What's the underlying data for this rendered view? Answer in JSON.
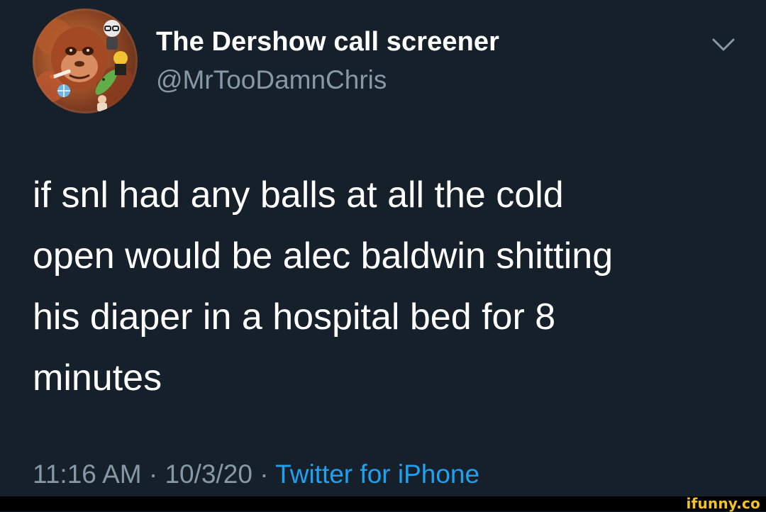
{
  "tweet": {
    "display_name": "The Dershow call screener",
    "handle": "@MrTooDamnChris",
    "text_lines": [
      "if snl had any balls at all the cold",
      "open would be alec baldwin shitting",
      "his diaper in a hospital bed for 8",
      "minutes"
    ],
    "time": "11:16 AM",
    "separator": "·",
    "date": "10/3/20",
    "source": "Twitter for iPhone"
  },
  "watermark": "ifunny.co",
  "colors": {
    "background": "#15202b",
    "text_primary": "#ffffff",
    "text_secondary": "#8899a6",
    "link": "#1da1f2",
    "watermark": "#f4c41e"
  },
  "icons": {
    "avatar": "avatar-image",
    "menu": "chevron-down-icon"
  }
}
